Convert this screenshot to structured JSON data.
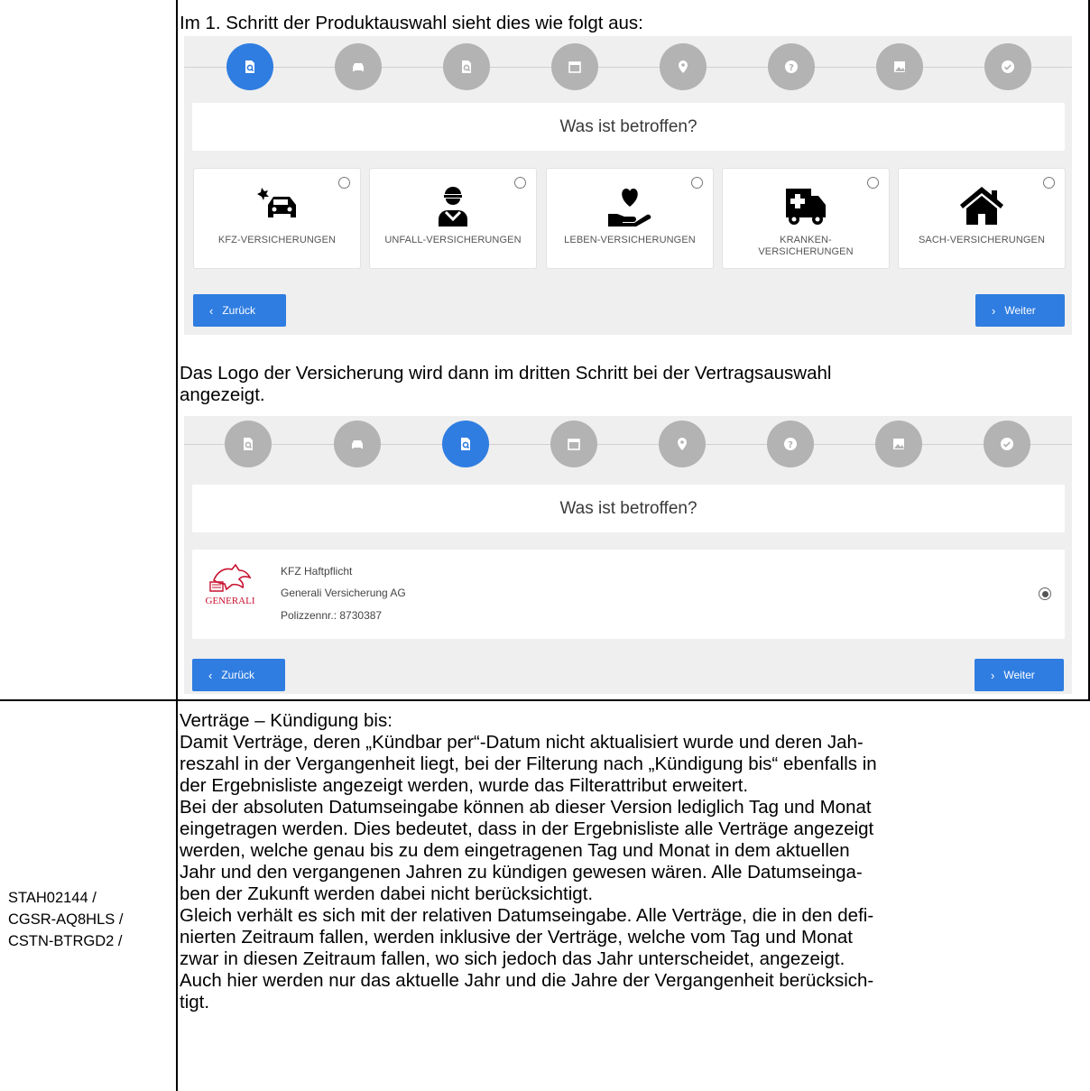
{
  "intro_text": "Im 1. Schritt der Produktauswahl sieht dies wie folgt aus:",
  "mid_text_lines": [
    "Das Logo der Versicherung wird dann im dritten Schritt bei der Vertragsauswahl",
    "angezeigt."
  ],
  "step_icons": [
    "search-document-icon",
    "car-icon",
    "search-document-icon",
    "calendar-icon",
    "location-pin-icon",
    "help-icon",
    "image-icon",
    "check-icon"
  ],
  "accent_color": "#2f7de1",
  "screen1": {
    "active_step": 1,
    "question": "Was ist betroffen?",
    "cards": [
      {
        "label": "KFZ-VERSICHERUNGEN",
        "icon": "car-crash-icon"
      },
      {
        "label": "UNFALL-VERSICHERUNGEN",
        "icon": "injured-person-icon"
      },
      {
        "label": "LEBEN-VERSICHERUNGEN",
        "icon": "heart-hand-icon"
      },
      {
        "label": "KRANKEN-VERSICHERUNGEN",
        "label_line1": "KRANKEN-",
        "label_line2": "VERSICHERUNGEN",
        "icon": "ambulance-icon"
      },
      {
        "label": "SACH-VERSICHERUNGEN",
        "icon": "house-icon"
      }
    ],
    "back_label": "Zurück",
    "next_label": "Weiter"
  },
  "screen2": {
    "active_step": 3,
    "question": "Was ist betroffen?",
    "contract": {
      "logo_text": "GENERALI",
      "product": "KFZ Haftpflicht",
      "insurer": "Generali Versicherung AG",
      "policy": "Polizzennr.: 8730387",
      "selected": true
    },
    "back_label": "Zurück",
    "next_label": "Weiter"
  },
  "ticket_ids": [
    "STAH02144 /",
    "CGSR-AQ8HLS /",
    "CSTN-BTRGD2 /"
  ],
  "section2_lines": [
    "Verträge – Kündigung bis:",
    "Damit Verträge, deren „Kündbar per“-Datum nicht aktualisiert wurde und deren Jah-",
    "reszahl in der Vergangenheit liegt, bei der Filterung nach „Kündigung bis“ ebenfalls in",
    "der Ergebnisliste angezeigt werden, wurde das Filterattribut erweitert.",
    "Bei der absoluten Datumseingabe können ab dieser Version lediglich Tag und Monat",
    "eingetragen werden. Dies bedeutet, dass in der Ergebnisliste alle Verträge angezeigt",
    "werden, welche genau bis zu dem eingetragenen Tag und Monat in dem aktuellen",
    "Jahr und den vergangenen Jahren zu kündigen gewesen wären. Alle Datumseinga-",
    "ben der Zukunft werden dabei nicht berücksichtigt.",
    "Gleich verhält es sich mit der relativen Datumseingabe. Alle Verträge, die in den defi-",
    "nierten Zeitraum fallen, werden inklusive der Verträge, welche vom Tag und Monat",
    "zwar in diesen Zeitraum fallen, wo sich jedoch das Jahr unterscheidet, angezeigt.",
    "Auch hier werden nur das aktuelle Jahr und die Jahre der Vergangenheit berücksich-",
    "tigt."
  ]
}
